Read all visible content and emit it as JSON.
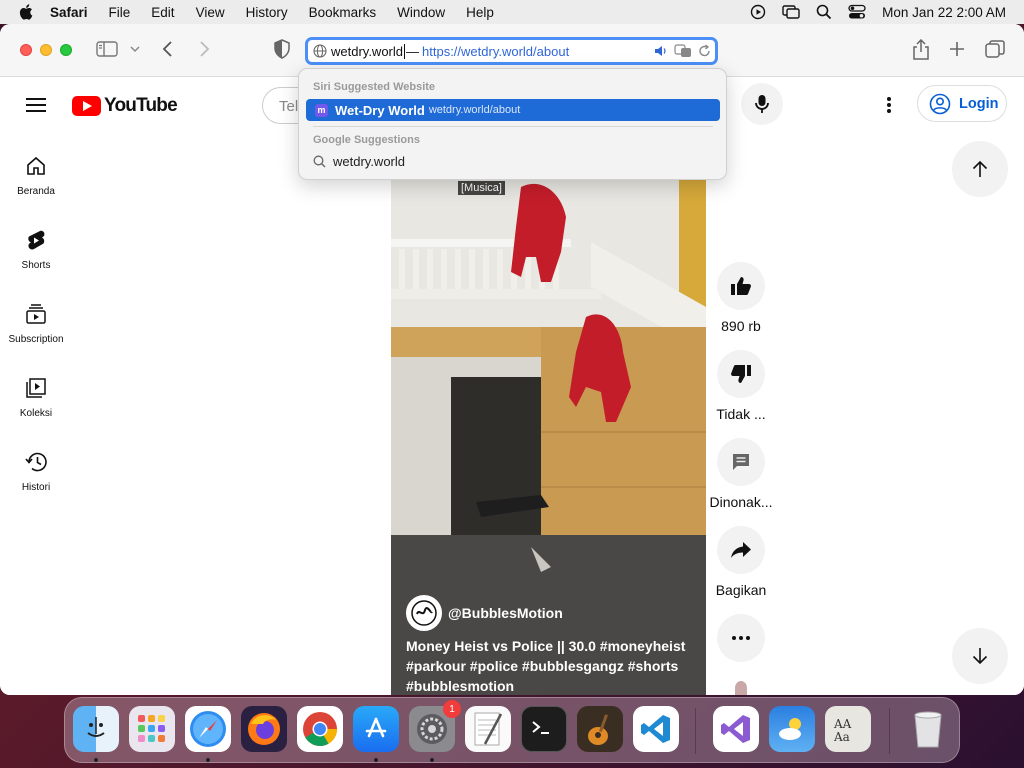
{
  "menubar": {
    "app_name": "Safari",
    "items": [
      "File",
      "Edit",
      "View",
      "History",
      "Bookmarks",
      "Window",
      "Help"
    ],
    "datetime": "Mon Jan 22  2:00 AM"
  },
  "addressbar": {
    "typed": "wetdry.world",
    "separator": "—",
    "completion": "https://wetdry.world/about"
  },
  "suggestions": {
    "siri_header": "Siri Suggested Website",
    "siri_item": {
      "title": "Wet-Dry World",
      "url": "wetdry.world/about"
    },
    "google_header": "Google Suggestions",
    "google_item": "wetdry.world"
  },
  "youtube": {
    "logo_text": "YouTube",
    "search_placeholder": "Tel",
    "login_label": "Login",
    "sidebar": [
      {
        "label": "Beranda",
        "icon": "home-icon"
      },
      {
        "label": "Shorts",
        "icon": "shorts-icon"
      },
      {
        "label": "Subscription",
        "icon": "subscriptions-icon"
      },
      {
        "label": "Koleksi",
        "icon": "library-icon"
      },
      {
        "label": "Histori",
        "icon": "history-icon"
      }
    ],
    "short": {
      "caption_tag": "[Musica]",
      "channel": "@BubblesMotion",
      "title": "Money Heist vs Police || 30.0 #moneyheist #parkour #police #bubblesgangz #shorts #bubblesmotion"
    },
    "actions": {
      "like": "890 rb",
      "dislike": "Tidak ...",
      "comments": "Dinonak...",
      "share": "Bagikan"
    }
  },
  "dock": {
    "apps": [
      "Finder",
      "Launchpad",
      "Safari",
      "Firefox",
      "Chrome",
      "App Store",
      "System Settings",
      "TextEdit",
      "Terminal",
      "GarageBand",
      "Visual Studio Code",
      "Visual Studio",
      "Weather",
      "Font Book",
      "Trash"
    ],
    "settings_badge": "1"
  },
  "colors": {
    "accent": "#1e6ad6",
    "youtube_red": "#ff0000",
    "login_blue": "#065fd4"
  }
}
